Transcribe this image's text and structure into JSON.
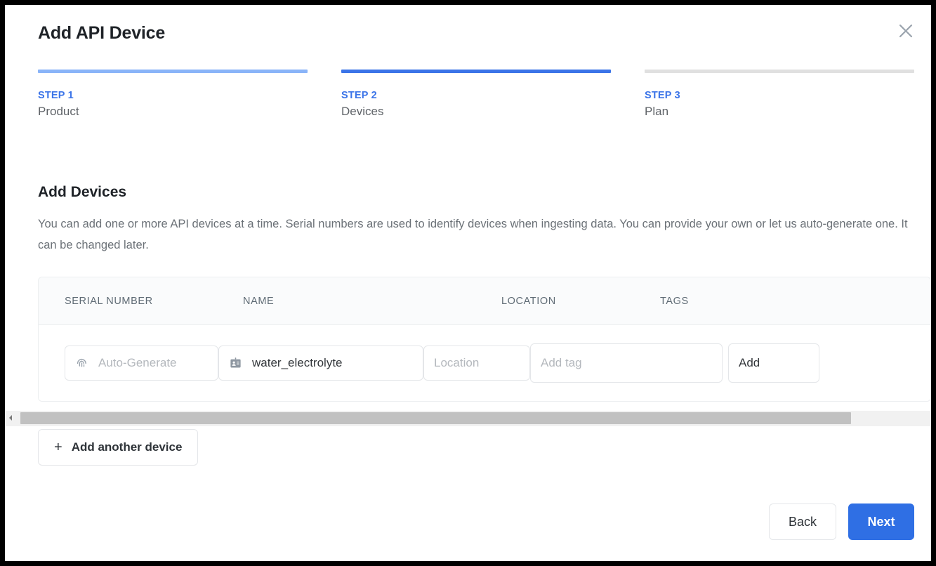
{
  "dialog": {
    "title": "Add API Device",
    "close_icon": "close-icon"
  },
  "stepper": {
    "steps": [
      {
        "num": "STEP 1",
        "label": "Product",
        "state": "done",
        "bar_color": "#8ab4f8"
      },
      {
        "num": "STEP 2",
        "label": "Devices",
        "state": "active",
        "bar_color": "#3b74e8"
      },
      {
        "num": "STEP 3",
        "label": "Plan",
        "state": "upcoming",
        "bar_color": "#e0e0e0"
      }
    ]
  },
  "section": {
    "title": "Add Devices",
    "description": "You can add one or more API devices at a time. Serial numbers are used to identify devices when ingesting data. You can provide your own or let us auto-generate one. It can be changed later."
  },
  "table": {
    "headers": {
      "serial_number": "SERIAL NUMBER",
      "name": "NAME",
      "location": "LOCATION",
      "tags": "TAGS"
    },
    "row": {
      "serial_placeholder": "Auto-Generate",
      "serial_icon": "fingerprint-icon",
      "name_value": "water_electrolyte",
      "name_icon": "id-badge-icon",
      "location_placeholder": "Location",
      "tag_placeholder": "Add tag",
      "add_tag_button": "Add"
    }
  },
  "scrollbar": {
    "left_arrow_icon": "chevron-left-icon"
  },
  "actions": {
    "add_another": "Add another device",
    "add_another_plus": "+",
    "back": "Back",
    "next": "Next"
  },
  "colors": {
    "accent": "#2f6fe4",
    "step_active": "#3b74e8",
    "step_done": "#8ab4f8",
    "step_upcoming": "#e0e0e0",
    "text_primary": "#1f2328",
    "text_muted": "#6b7177"
  }
}
